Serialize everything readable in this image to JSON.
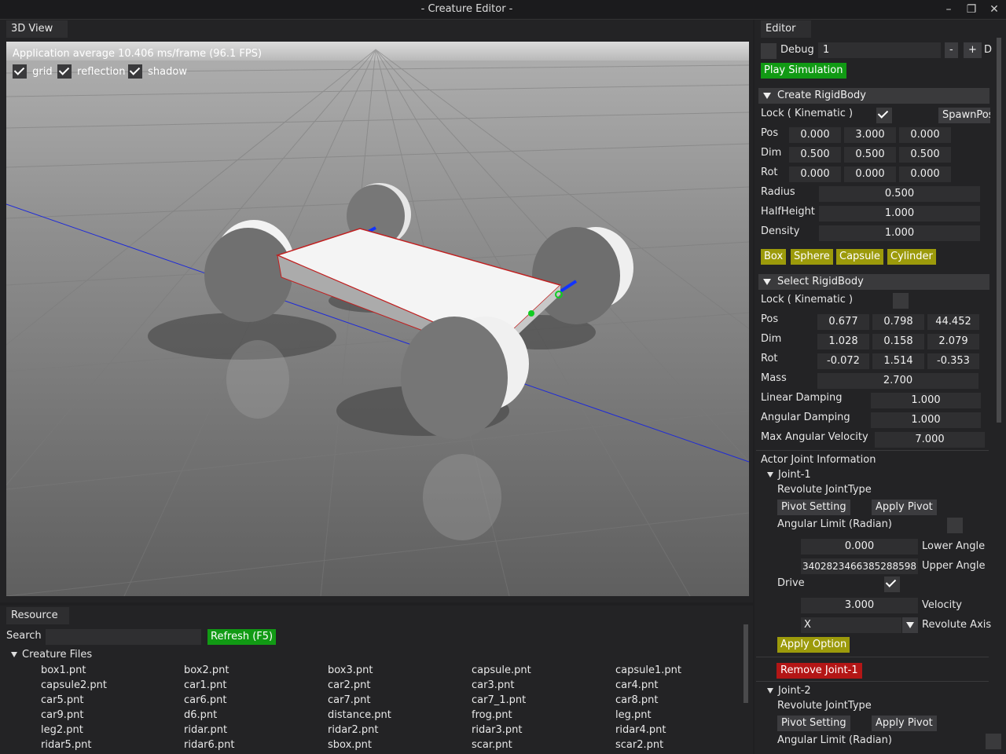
{
  "window": {
    "title": "- Creature Editor -",
    "minimize_icon": "minimize-icon",
    "maximize_icon": "maximize-icon",
    "close_icon": "close-icon"
  },
  "view3d": {
    "tab_label": "3D View",
    "fps_text": "Application average 10.406 ms/frame (96.1 FPS)",
    "toggles": [
      {
        "label": "grid",
        "checked": true
      },
      {
        "label": "reflection",
        "checked": true
      },
      {
        "label": "shadow",
        "checked": true
      }
    ]
  },
  "resource": {
    "tab_label": "Resource",
    "search_label": "Search",
    "search_value": "",
    "refresh_label": "Refresh (F5)",
    "tree_label": "Creature Files",
    "files": [
      "box1.pnt",
      "box2.pnt",
      "box3.pnt",
      "capsule.pnt",
      "capsule1.pnt",
      "capsule2.pnt",
      "car1.pnt",
      "car2.pnt",
      "car3.pnt",
      "car4.pnt",
      "car5.pnt",
      "car6.pnt",
      "car7.pnt",
      "car7_1.pnt",
      "car8.pnt",
      "car9.pnt",
      "d6.pnt",
      "distance.pnt",
      "frog.pnt",
      "leg.pnt",
      "leg2.pnt",
      "ridar.pnt",
      "ridar2.pnt",
      "ridar3.pnt",
      "ridar4.pnt",
      "ridar5.pnt",
      "ridar6.pnt",
      "sbox.pnt",
      "scar.pnt",
      "scar2.pnt"
    ]
  },
  "editor": {
    "tab_label": "Editor",
    "debug_label": "Debug",
    "debug_value": "1",
    "minus_label": "-",
    "plus_label": "+",
    "d_label": "D",
    "play_label": "Play Simulation",
    "create": {
      "header": "Create RigidBody",
      "lock_label": "Lock ( Kinematic )",
      "lock_checked": true,
      "spawnpos_label": "SpawnPos",
      "pos_label": "Pos",
      "pos": [
        "0.000",
        "3.000",
        "0.000"
      ],
      "dim_label": "Dim",
      "dim": [
        "0.500",
        "0.500",
        "0.500"
      ],
      "rot_label": "Rot",
      "rot": [
        "0.000",
        "0.000",
        "0.000"
      ],
      "radius_label": "Radius",
      "radius": "0.500",
      "halfheight_label": "HalfHeight",
      "halfheight": "1.000",
      "density_label": "Density",
      "density": "1.000",
      "shape_buttons": [
        "Box",
        "Sphere",
        "Capsule",
        "Cylinder"
      ]
    },
    "select": {
      "header": "Select RigidBody",
      "lock_label": "Lock ( Kinematic )",
      "lock_checked": false,
      "pos_label": "Pos",
      "pos": [
        "0.677",
        "0.798",
        "44.452"
      ],
      "dim_label": "Dim",
      "dim": [
        "1.028",
        "0.158",
        "2.079"
      ],
      "rot_label": "Rot",
      "rot": [
        "-0.072",
        "1.514",
        "-0.353"
      ],
      "mass_label": "Mass",
      "mass": "2.700",
      "lin_damp_label": "Linear Damping",
      "lin_damp": "1.000",
      "ang_damp_label": "Angular Damping",
      "ang_damp": "1.000",
      "max_ang_label": "Max Angular Velocity",
      "max_ang": "7.000"
    },
    "joints": {
      "title": "Actor Joint Information",
      "joint1": {
        "name": "Joint-1",
        "type": "Revolute JointType",
        "pivot_setting": "Pivot Setting",
        "apply_pivot": "Apply Pivot",
        "angular_limit": "Angular Limit (Radian)",
        "lower_value": "0.000",
        "lower_label": "Lower Angle",
        "upper_value": "3402823466385288598",
        "upper_label": "Upper Angle",
        "drive_label": "Drive",
        "drive_checked": true,
        "velocity_value": "3.000",
        "velocity_label": "Velocity",
        "axis_value": "X",
        "axis_label": "Revolute Axis",
        "apply_option": "Apply Option",
        "remove": "Remove Joint-1"
      },
      "joint2": {
        "name": "Joint-2",
        "type": "Revolute JointType",
        "pivot_setting": "Pivot Setting",
        "apply_pivot": "Apply Pivot",
        "angular_limit": "Angular Limit (Radian)"
      }
    }
  }
}
